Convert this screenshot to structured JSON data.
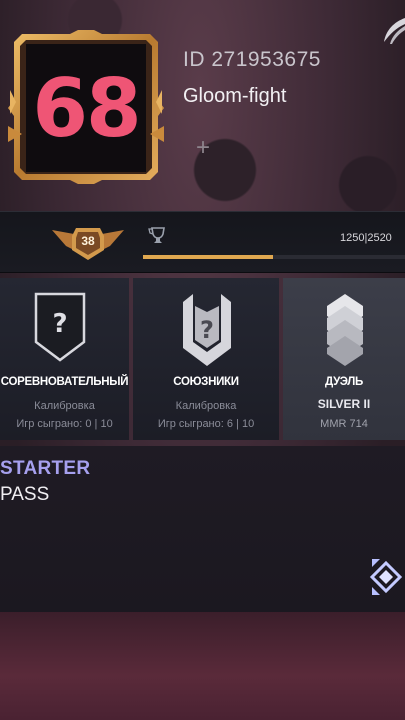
{
  "profile": {
    "rank_value": "68",
    "id_text": "ID 271953675",
    "name": "Gloom-fight",
    "add_glyph": "+"
  },
  "level": {
    "number": "38",
    "xp_text": "1250|2520",
    "xp_progress": 0.496
  },
  "modes": [
    {
      "title": "СОРЕВНОВАТЕЛЬНЫЙ",
      "status": "Калибровка",
      "games": "Игр сыграно: 0 | 10",
      "icon": "unknown-rank-shield-icon"
    },
    {
      "title": "СОЮЗНИКИ",
      "status": "Калибровка",
      "games": "Игр сыграно: 6 | 10",
      "icon": "unknown-rank-banner-icon"
    },
    {
      "title": "ДУЭЛЬ",
      "rank": "SILVER II",
      "mmr": "MMR 714",
      "icon": "silver-rank-icon"
    }
  ],
  "pass": {
    "title": "STARTER",
    "subtitle": "PASS",
    "icon": "pass-emblem-icon"
  },
  "colors": {
    "rank_number": "#ef5575",
    "pass_title": "#a6a0ee",
    "xp_fill": "#e0a850",
    "frame_gold": "#c9893a"
  }
}
